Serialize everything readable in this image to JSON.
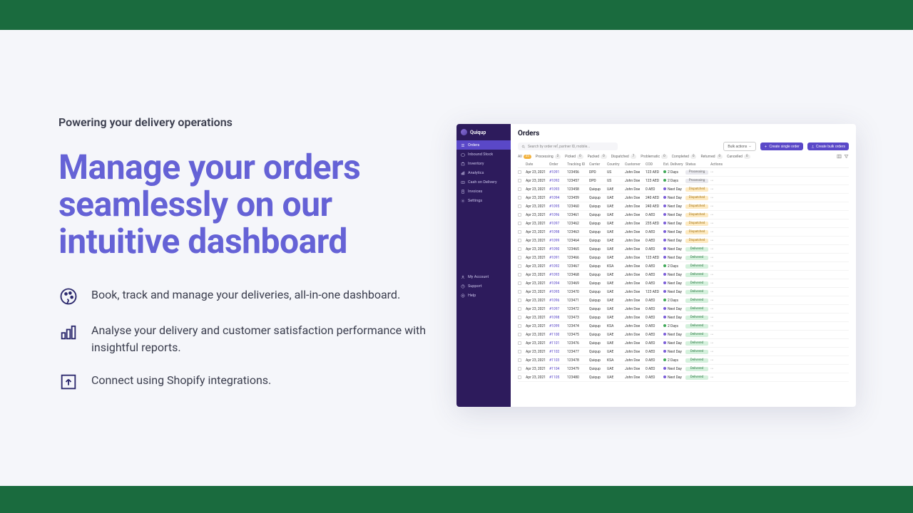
{
  "top_bar_color": "#1a6b3e",
  "hero": {
    "eyebrow": "Powering your delivery operations",
    "headline": "Manage your orders seamlessly on our intuitive dashboard",
    "features": [
      "Book, track and manage your deliveries, all-in-one dashboard.",
      "Analyse your delivery and customer satisfaction performance with insightful reports.",
      "Connect using Shopify integrations."
    ]
  },
  "dashboard": {
    "brand": "Quiqup",
    "nav": {
      "items": [
        "Orders",
        "Inbound Stock",
        "Inventory",
        "Analytics",
        "Cash on Delivery",
        "Invoices",
        "Settings"
      ],
      "bottom": [
        "My Account",
        "Support",
        "Help"
      ]
    },
    "title": "Orders",
    "search_placeholder": "Search by order ref, partner ID, mobile...",
    "bulk_actions_label": "Bulk actions",
    "create_single_label": "Create single order",
    "create_bulk_label": "Create bulk orders",
    "tabs": [
      {
        "label": "All",
        "count": "25"
      },
      {
        "label": "Processing",
        "count": "2"
      },
      {
        "label": "Picked",
        "count": "0"
      },
      {
        "label": "Packed",
        "count": "0"
      },
      {
        "label": "Dispatched",
        "count": "7"
      },
      {
        "label": "Problematic",
        "count": "0"
      },
      {
        "label": "Completed",
        "count": "0"
      },
      {
        "label": "Returned",
        "count": "0"
      },
      {
        "label": "Cancelled",
        "count": "0"
      }
    ],
    "columns": [
      "",
      "Date",
      "Order",
      "Tracking ID",
      "Carrier",
      "Country",
      "Customer",
      "COD",
      "Est. Delivery",
      "Status",
      "Actions"
    ],
    "rows": [
      {
        "date": "Apr 23, 2021",
        "order": "#1091",
        "tracking": "123456",
        "carrier": "DPD",
        "country": "US",
        "customer": "John Doe",
        "cod": "123 AED",
        "est": "2 Days",
        "est_dot": "green",
        "status": "Processing"
      },
      {
        "date": "Apr 23, 2021",
        "order": "#1092",
        "tracking": "123457",
        "carrier": "DPD",
        "country": "US",
        "customer": "John Doe",
        "cod": "123 AED",
        "est": "2 Days",
        "est_dot": "green",
        "status": "Processing"
      },
      {
        "date": "Apr 23, 2021",
        "order": "#1093",
        "tracking": "123458",
        "carrier": "Quiqup",
        "country": "UAE",
        "customer": "John Doe",
        "cod": "0 AED",
        "est": "Next Day",
        "est_dot": "purple",
        "status": "Dispatched"
      },
      {
        "date": "Apr 23, 2021",
        "order": "#1094",
        "tracking": "123459",
        "carrier": "Quiqup",
        "country": "UAE",
        "customer": "John Doe",
        "cod": "240 AED",
        "est": "Next Day",
        "est_dot": "purple",
        "status": "Dispatched"
      },
      {
        "date": "Apr 23, 2021",
        "order": "#1095",
        "tracking": "123460",
        "carrier": "Quiqup",
        "country": "UAE",
        "customer": "John Doe",
        "cod": "240 AED",
        "est": "Next Day",
        "est_dot": "purple",
        "status": "Dispatched"
      },
      {
        "date": "Apr 23, 2021",
        "order": "#1096",
        "tracking": "123461",
        "carrier": "Quiqup",
        "country": "UAE",
        "customer": "John Doe",
        "cod": "0 AED",
        "est": "Next Day",
        "est_dot": "purple",
        "status": "Dispatched"
      },
      {
        "date": "Apr 23, 2021",
        "order": "#1097",
        "tracking": "123462",
        "carrier": "Quiqup",
        "country": "UAE",
        "customer": "John Doe",
        "cod": "235 AED",
        "est": "Next Day",
        "est_dot": "purple",
        "status": "Dispatched"
      },
      {
        "date": "Apr 23, 2021",
        "order": "#1098",
        "tracking": "123463",
        "carrier": "Quiqup",
        "country": "UAE",
        "customer": "John Doe",
        "cod": "0 AED",
        "est": "Next Day",
        "est_dot": "purple",
        "status": "Dispatched"
      },
      {
        "date": "Apr 23, 2021",
        "order": "#1099",
        "tracking": "123464",
        "carrier": "Quiqup",
        "country": "UAE",
        "customer": "John Doe",
        "cod": "0 AED",
        "est": "Next Day",
        "est_dot": "purple",
        "status": "Dispatched"
      },
      {
        "date": "Apr 23, 2021",
        "order": "#1090",
        "tracking": "123465",
        "carrier": "Quiqup",
        "country": "UAE",
        "customer": "John Doe",
        "cod": "0 AED",
        "est": "Next Day",
        "est_dot": "purple",
        "status": "Delivered"
      },
      {
        "date": "Apr 23, 2021",
        "order": "#1091",
        "tracking": "123466",
        "carrier": "Quiqup",
        "country": "UAE",
        "customer": "John Doe",
        "cod": "123 AED",
        "est": "Next Day",
        "est_dot": "purple",
        "status": "Delivered"
      },
      {
        "date": "Apr 23, 2021",
        "order": "#1092",
        "tracking": "123467",
        "carrier": "Quiqup",
        "country": "KSA",
        "customer": "John Doe",
        "cod": "0 AED",
        "est": "2 Days",
        "est_dot": "green",
        "status": "Delivered"
      },
      {
        "date": "Apr 23, 2021",
        "order": "#1093",
        "tracking": "123468",
        "carrier": "Quiqup",
        "country": "UAE",
        "customer": "John Doe",
        "cod": "0 AED",
        "est": "Next Day",
        "est_dot": "purple",
        "status": "Delivered"
      },
      {
        "date": "Apr 23, 2021",
        "order": "#1094",
        "tracking": "123469",
        "carrier": "Quiqup",
        "country": "UAE",
        "customer": "John Doe",
        "cod": "0 AED",
        "est": "Next Day",
        "est_dot": "purple",
        "status": "Delivered"
      },
      {
        "date": "Apr 23, 2021",
        "order": "#1095",
        "tracking": "123470",
        "carrier": "Quiqup",
        "country": "UAE",
        "customer": "John Doe",
        "cod": "123 AED",
        "est": "Next Day",
        "est_dot": "purple",
        "status": "Delivered"
      },
      {
        "date": "Apr 23, 2021",
        "order": "#1096",
        "tracking": "123471",
        "carrier": "Quiqup",
        "country": "UAE",
        "customer": "John Doe",
        "cod": "0 AED",
        "est": "2 Days",
        "est_dot": "green",
        "status": "Delivered"
      },
      {
        "date": "Apr 23, 2021",
        "order": "#1097",
        "tracking": "123472",
        "carrier": "Quiqup",
        "country": "UAE",
        "customer": "John Doe",
        "cod": "0 AED",
        "est": "Next Day",
        "est_dot": "purple",
        "status": "Delivered"
      },
      {
        "date": "Apr 23, 2021",
        "order": "#1098",
        "tracking": "123473",
        "carrier": "Quiqup",
        "country": "UAE",
        "customer": "John Doe",
        "cod": "0 AED",
        "est": "Next Day",
        "est_dot": "purple",
        "status": "Delivered"
      },
      {
        "date": "Apr 23, 2021",
        "order": "#1099",
        "tracking": "123474",
        "carrier": "Quiqup",
        "country": "KSA",
        "customer": "John Doe",
        "cod": "0 AED",
        "est": "2 Days",
        "est_dot": "green",
        "status": "Delivered"
      },
      {
        "date": "Apr 23, 2021",
        "order": "#1100",
        "tracking": "123475",
        "carrier": "Quiqup",
        "country": "UAE",
        "customer": "John Doe",
        "cod": "0 AED",
        "est": "Next Day",
        "est_dot": "purple",
        "status": "Delivered"
      },
      {
        "date": "Apr 23, 2021",
        "order": "#1101",
        "tracking": "123476",
        "carrier": "Quiqup",
        "country": "UAE",
        "customer": "John Doe",
        "cod": "0 AED",
        "est": "Next Day",
        "est_dot": "purple",
        "status": "Delivered"
      },
      {
        "date": "Apr 23, 2021",
        "order": "#1102",
        "tracking": "123477",
        "carrier": "Quiqup",
        "country": "UAE",
        "customer": "John Doe",
        "cod": "0 AED",
        "est": "Next Day",
        "est_dot": "purple",
        "status": "Delivered"
      },
      {
        "date": "Apr 23, 2021",
        "order": "#1103",
        "tracking": "123478",
        "carrier": "Quiqup",
        "country": "KSA",
        "customer": "John Doe",
        "cod": "0 AED",
        "est": "2 Days",
        "est_dot": "green",
        "status": "Delivered"
      },
      {
        "date": "Apr 23, 2021",
        "order": "#1104",
        "tracking": "123479",
        "carrier": "Quiqup",
        "country": "UAE",
        "customer": "John Doe",
        "cod": "0 AED",
        "est": "Next Day",
        "est_dot": "purple",
        "status": "Delivered"
      },
      {
        "date": "Apr 23, 2021",
        "order": "#1105",
        "tracking": "123480",
        "carrier": "Quiqup",
        "country": "UAE",
        "customer": "John Doe",
        "cod": "0 AED",
        "est": "Next Day",
        "est_dot": "purple",
        "status": "Delivered"
      }
    ]
  }
}
